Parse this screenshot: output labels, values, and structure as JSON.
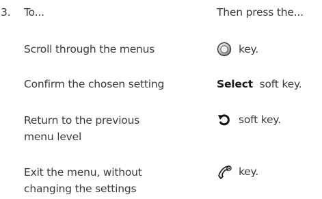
{
  "step": {
    "number": "3.",
    "header_left": "To...",
    "header_right": "Then press the..."
  },
  "rows": [
    {
      "action": "Scroll through the menus",
      "icon": "navigation-key-icon",
      "key_text": "key."
    },
    {
      "action": "Confirm the chosen setting",
      "key_bold": "Select",
      "key_text": "soft key."
    },
    {
      "action_line1": "Return to the previous",
      "action_line2": "menu level",
      "icon": "back-arrow-icon",
      "key_text": "soft key."
    },
    {
      "action_line1": "Exit the menu, without",
      "action_line2": "changing the settings",
      "icon": "end-call-key-icon",
      "key_text": "key."
    }
  ]
}
